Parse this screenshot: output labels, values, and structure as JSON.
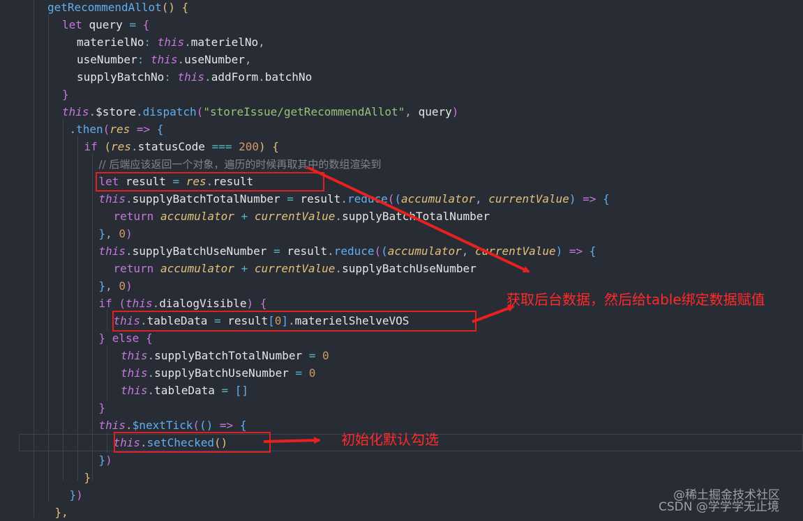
{
  "code_lines": [
    {
      "indent": 0,
      "tokens": [
        [
          "fn",
          "getRecommendAllot"
        ],
        [
          "b1",
          "()"
        ],
        [
          "plain",
          " "
        ],
        [
          "b1",
          "{"
        ]
      ]
    },
    {
      "indent": 1,
      "tokens": [
        [
          "key",
          "let"
        ],
        [
          "plain",
          " query "
        ],
        [
          "op",
          "="
        ],
        [
          "plain",
          " "
        ],
        [
          "b2",
          "{"
        ]
      ]
    },
    {
      "indent": 2,
      "tokens": [
        [
          "prop",
          "materielNo"
        ],
        [
          "op",
          ":"
        ],
        [
          "plain",
          " "
        ],
        [
          "this",
          "this"
        ],
        [
          "punc",
          "."
        ],
        [
          "prop",
          "materielNo"
        ],
        [
          "punc",
          ","
        ]
      ]
    },
    {
      "indent": 2,
      "tokens": [
        [
          "prop",
          "useNumber"
        ],
        [
          "op",
          ":"
        ],
        [
          "plain",
          " "
        ],
        [
          "this",
          "this"
        ],
        [
          "punc",
          "."
        ],
        [
          "prop",
          "useNumber"
        ],
        [
          "punc",
          ","
        ]
      ]
    },
    {
      "indent": 2,
      "tokens": [
        [
          "prop",
          "supplyBatchNo"
        ],
        [
          "op",
          ":"
        ],
        [
          "plain",
          " "
        ],
        [
          "this",
          "this"
        ],
        [
          "punc",
          "."
        ],
        [
          "prop",
          "addForm"
        ],
        [
          "punc",
          "."
        ],
        [
          "prop",
          "batchNo"
        ]
      ]
    },
    {
      "indent": 1,
      "tokens": [
        [
          "b2",
          "}"
        ]
      ]
    },
    {
      "indent": 1,
      "tokens": [
        [
          "this",
          "this"
        ],
        [
          "punc",
          "."
        ],
        [
          "prop",
          "$store"
        ],
        [
          "punc",
          "."
        ],
        [
          "fn",
          "dispatch"
        ],
        [
          "b2",
          "("
        ],
        [
          "str",
          "\"storeIssue/getRecommendAllot\""
        ],
        [
          "punc",
          ","
        ],
        [
          "plain",
          " query"
        ],
        [
          "b2",
          ")"
        ]
      ]
    },
    {
      "indent": 1.5,
      "tokens": [
        [
          "punc",
          "."
        ],
        [
          "fn",
          "then"
        ],
        [
          "b2",
          "("
        ],
        [
          "param",
          "res"
        ],
        [
          "plain",
          " "
        ],
        [
          "key",
          "=>"
        ],
        [
          "plain",
          " "
        ],
        [
          "b3",
          "{"
        ]
      ]
    },
    {
      "indent": 2.5,
      "tokens": [
        [
          "key",
          "if"
        ],
        [
          "plain",
          " "
        ],
        [
          "b1",
          "("
        ],
        [
          "param",
          "res"
        ],
        [
          "punc",
          "."
        ],
        [
          "prop",
          "statusCode"
        ],
        [
          "plain",
          " "
        ],
        [
          "op",
          "==="
        ],
        [
          "plain",
          " "
        ],
        [
          "num",
          "200"
        ],
        [
          "b1",
          ")"
        ],
        [
          "plain",
          " "
        ],
        [
          "b1",
          "{"
        ]
      ]
    },
    {
      "indent": 3.5,
      "tokens": [
        [
          "cm",
          "// 后端应该返回一个对象，遍历的时候再取其中的数组渲染到"
        ]
      ]
    },
    {
      "indent": 3.5,
      "tokens": [
        [
          "key",
          "let"
        ],
        [
          "plain",
          " result "
        ],
        [
          "op",
          "="
        ],
        [
          "plain",
          " "
        ],
        [
          "param",
          "res"
        ],
        [
          "punc",
          "."
        ],
        [
          "prop",
          "result"
        ]
      ]
    },
    {
      "indent": 3.5,
      "tokens": [
        [
          "this",
          "this"
        ],
        [
          "punc",
          "."
        ],
        [
          "prop",
          "supplyBatchTotalNumber"
        ],
        [
          "plain",
          " "
        ],
        [
          "op",
          "="
        ],
        [
          "plain",
          " result"
        ],
        [
          "punc",
          "."
        ],
        [
          "fn",
          "reduce"
        ],
        [
          "b2",
          "("
        ],
        [
          "b3",
          "("
        ],
        [
          "param",
          "accumulator"
        ],
        [
          "punc",
          ","
        ],
        [
          "plain",
          " "
        ],
        [
          "param",
          "currentValue"
        ],
        [
          "b3",
          ")"
        ],
        [
          "plain",
          " "
        ],
        [
          "key",
          "=>"
        ],
        [
          "plain",
          " "
        ],
        [
          "b3",
          "{"
        ]
      ]
    },
    {
      "indent": 4.5,
      "tokens": [
        [
          "key",
          "return"
        ],
        [
          "plain",
          " "
        ],
        [
          "param",
          "accumulator"
        ],
        [
          "plain",
          " "
        ],
        [
          "op",
          "+"
        ],
        [
          "plain",
          " "
        ],
        [
          "param",
          "currentValue"
        ],
        [
          "punc",
          "."
        ],
        [
          "prop",
          "supplyBatchTotalNumber"
        ]
      ]
    },
    {
      "indent": 3.5,
      "tokens": [
        [
          "b3",
          "}"
        ],
        [
          "punc",
          ","
        ],
        [
          "plain",
          " "
        ],
        [
          "num",
          "0"
        ],
        [
          "b2",
          ")"
        ]
      ]
    },
    {
      "indent": 3.5,
      "tokens": [
        [
          "this",
          "this"
        ],
        [
          "punc",
          "."
        ],
        [
          "prop",
          "supplyBatchUseNumber"
        ],
        [
          "plain",
          " "
        ],
        [
          "op",
          "="
        ],
        [
          "plain",
          " result"
        ],
        [
          "punc",
          "."
        ],
        [
          "fn",
          "reduce"
        ],
        [
          "b2",
          "("
        ],
        [
          "b3",
          "("
        ],
        [
          "param",
          "accumulator"
        ],
        [
          "punc",
          ","
        ],
        [
          "plain",
          " "
        ],
        [
          "param",
          "currentValue"
        ],
        [
          "b3",
          ")"
        ],
        [
          "plain",
          " "
        ],
        [
          "key",
          "=>"
        ],
        [
          "plain",
          " "
        ],
        [
          "b3",
          "{"
        ]
      ]
    },
    {
      "indent": 4.5,
      "tokens": [
        [
          "key",
          "return"
        ],
        [
          "plain",
          " "
        ],
        [
          "param",
          "accumulator"
        ],
        [
          "plain",
          " "
        ],
        [
          "op",
          "+"
        ],
        [
          "plain",
          " "
        ],
        [
          "param",
          "currentValue"
        ],
        [
          "punc",
          "."
        ],
        [
          "prop",
          "supplyBatchUseNumber"
        ]
      ]
    },
    {
      "indent": 3.5,
      "tokens": [
        [
          "b3",
          "}"
        ],
        [
          "punc",
          ","
        ],
        [
          "plain",
          " "
        ],
        [
          "num",
          "0"
        ],
        [
          "b2",
          ")"
        ]
      ]
    },
    {
      "indent": 3.5,
      "tokens": [
        [
          "key",
          "if"
        ],
        [
          "plain",
          " "
        ],
        [
          "b2",
          "("
        ],
        [
          "this",
          "this"
        ],
        [
          "punc",
          "."
        ],
        [
          "prop",
          "dialogVisible"
        ],
        [
          "b2",
          ")"
        ],
        [
          "plain",
          " "
        ],
        [
          "b2",
          "{"
        ]
      ]
    },
    {
      "indent": 4.5,
      "tokens": [
        [
          "this",
          "this"
        ],
        [
          "punc",
          "."
        ],
        [
          "prop",
          "tableData"
        ],
        [
          "plain",
          " "
        ],
        [
          "op",
          "="
        ],
        [
          "plain",
          " result"
        ],
        [
          "b3",
          "["
        ],
        [
          "num",
          "0"
        ],
        [
          "b3",
          "]"
        ],
        [
          "punc",
          "."
        ],
        [
          "prop",
          "materielShelveVOS"
        ]
      ]
    },
    {
      "indent": 3.5,
      "tokens": [
        [
          "b2",
          "}"
        ],
        [
          "plain",
          " "
        ],
        [
          "key",
          "else"
        ],
        [
          "plain",
          " "
        ],
        [
          "b2",
          "{"
        ]
      ]
    },
    {
      "indent": 5,
      "tokens": [
        [
          "this",
          "this"
        ],
        [
          "punc",
          "."
        ],
        [
          "prop",
          "supplyBatchTotalNumber"
        ],
        [
          "plain",
          " "
        ],
        [
          "op",
          "="
        ],
        [
          "plain",
          " "
        ],
        [
          "num",
          "0"
        ]
      ]
    },
    {
      "indent": 5,
      "tokens": [
        [
          "this",
          "this"
        ],
        [
          "punc",
          "."
        ],
        [
          "prop",
          "supplyBatchUseNumber"
        ],
        [
          "plain",
          " "
        ],
        [
          "op",
          "="
        ],
        [
          "plain",
          " "
        ],
        [
          "num",
          "0"
        ]
      ]
    },
    {
      "indent": 5,
      "tokens": [
        [
          "this",
          "this"
        ],
        [
          "punc",
          "."
        ],
        [
          "prop",
          "tableData"
        ],
        [
          "plain",
          " "
        ],
        [
          "op",
          "="
        ],
        [
          "plain",
          " "
        ],
        [
          "b3",
          "[]"
        ]
      ]
    },
    {
      "indent": 3.5,
      "tokens": [
        [
          "b2",
          "}"
        ]
      ]
    },
    {
      "indent": 3.5,
      "tokens": [
        [
          "this",
          "this"
        ],
        [
          "punc",
          "."
        ],
        [
          "fn",
          "$nextTick"
        ],
        [
          "b2",
          "("
        ],
        [
          "b3",
          "()"
        ],
        [
          "plain",
          " "
        ],
        [
          "key",
          "=>"
        ],
        [
          "plain",
          " "
        ],
        [
          "b3",
          "{"
        ]
      ]
    },
    {
      "indent": 4.5,
      "tokens": [
        [
          "this",
          "this"
        ],
        [
          "punc",
          "."
        ],
        [
          "fn",
          "setChecked"
        ],
        [
          "b1",
          "()"
        ]
      ]
    },
    {
      "indent": 3.5,
      "tokens": [
        [
          "b3",
          "}"
        ],
        [
          "b2",
          ")"
        ]
      ]
    },
    {
      "indent": 2.5,
      "tokens": [
        [
          "b1",
          "}"
        ]
      ]
    },
    {
      "indent": 1.5,
      "tokens": [
        [
          "b3",
          "}"
        ],
        [
          "b2",
          ")"
        ]
      ]
    },
    {
      "indent": 0.5,
      "tokens": [
        [
          "b1",
          "},"
        ]
      ]
    }
  ],
  "annotations": {
    "fetch_note": "获取后台数据，然后给table绑定数据赋值",
    "init_note": "初始化默认勾选"
  },
  "watermarks": {
    "platform": "@稀土掘金技术社区",
    "author": "CSDN @学学学无止境"
  },
  "colors": {
    "background": "#282c34",
    "keyword": "#c678dd",
    "function": "#61afef",
    "string": "#98c379",
    "number": "#d19a66",
    "parameter": "#e5c07b",
    "annotation": "#ff2a2a"
  }
}
